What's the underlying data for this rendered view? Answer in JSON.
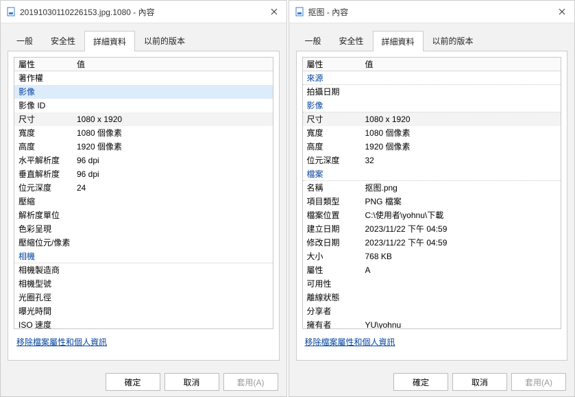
{
  "dialogs": [
    {
      "title": "20191030110226153.jpg.1080 - 內容",
      "tabs": [
        "一般",
        "安全性",
        "詳細資料",
        "以前的版本"
      ],
      "activeTab": 2,
      "header": {
        "k": "屬性",
        "v": "值"
      },
      "rows": [
        {
          "type": "item",
          "k": "著作權",
          "v": ""
        },
        {
          "type": "section2",
          "k": "影像",
          "v": ""
        },
        {
          "type": "item",
          "k": "影像 ID",
          "v": ""
        },
        {
          "type": "item",
          "alt": true,
          "k": "尺寸",
          "v": "1080 x 1920"
        },
        {
          "type": "item",
          "k": "寬度",
          "v": "1080 個像素"
        },
        {
          "type": "item",
          "k": "高度",
          "v": "1920 個像素"
        },
        {
          "type": "item",
          "k": "水平解析度",
          "v": "96 dpi"
        },
        {
          "type": "item",
          "k": "垂直解析度",
          "v": "96 dpi"
        },
        {
          "type": "item",
          "k": "位元深度",
          "v": "24"
        },
        {
          "type": "item",
          "k": "壓縮",
          "v": ""
        },
        {
          "type": "item",
          "k": "解析度單位",
          "v": ""
        },
        {
          "type": "item",
          "k": "色彩呈現",
          "v": ""
        },
        {
          "type": "item",
          "k": "壓縮位元/像素",
          "v": ""
        },
        {
          "type": "section",
          "k": "相機",
          "v": ""
        },
        {
          "type": "item",
          "k": "相機製造商",
          "v": ""
        },
        {
          "type": "item",
          "k": "相機型號",
          "v": ""
        },
        {
          "type": "item",
          "k": "光圈孔徑",
          "v": ""
        },
        {
          "type": "item",
          "k": "曝光時間",
          "v": ""
        },
        {
          "type": "item",
          "k": "ISO 速度",
          "v": ""
        }
      ],
      "link": "移除檔案屬性和個人資訊",
      "buttons": [
        "確定",
        "取消",
        "套用(A)"
      ]
    },
    {
      "title": "抠图 - 內容",
      "tabs": [
        "一般",
        "安全性",
        "詳細資料",
        "以前的版本"
      ],
      "activeTab": 2,
      "header": {
        "k": "屬性",
        "v": "值"
      },
      "rows": [
        {
          "type": "section",
          "k": "來源",
          "v": ""
        },
        {
          "type": "item",
          "k": "拍攝日期",
          "v": ""
        },
        {
          "type": "section",
          "k": "影像",
          "v": ""
        },
        {
          "type": "item",
          "alt": true,
          "k": "尺寸",
          "v": "1080 x 1920"
        },
        {
          "type": "item",
          "k": "寬度",
          "v": "1080 個像素"
        },
        {
          "type": "item",
          "k": "高度",
          "v": "1920 個像素"
        },
        {
          "type": "item",
          "k": "位元深度",
          "v": "32"
        },
        {
          "type": "section",
          "k": "檔案",
          "v": ""
        },
        {
          "type": "item",
          "k": "名稱",
          "v": "抠图.png"
        },
        {
          "type": "item",
          "k": "項目類型",
          "v": "PNG 檔案"
        },
        {
          "type": "item",
          "k": "檔案位置",
          "v": "C:\\使用者\\yohnu\\下載"
        },
        {
          "type": "item",
          "k": "建立日期",
          "v": "2023/11/22 下午 04:59"
        },
        {
          "type": "item",
          "k": "修改日期",
          "v": "2023/11/22 下午 04:59"
        },
        {
          "type": "item",
          "k": "大小",
          "v": "768 KB"
        },
        {
          "type": "item",
          "k": "屬性",
          "v": "A"
        },
        {
          "type": "item",
          "k": "可用性",
          "v": ""
        },
        {
          "type": "item",
          "k": "離線狀態",
          "v": ""
        },
        {
          "type": "item",
          "k": "分享者",
          "v": ""
        },
        {
          "type": "item",
          "k": "擁有者",
          "v": "YU\\yohnu"
        }
      ],
      "link": "移除檔案屬性和個人資訊",
      "buttons": [
        "確定",
        "取消",
        "套用(A)"
      ]
    }
  ]
}
